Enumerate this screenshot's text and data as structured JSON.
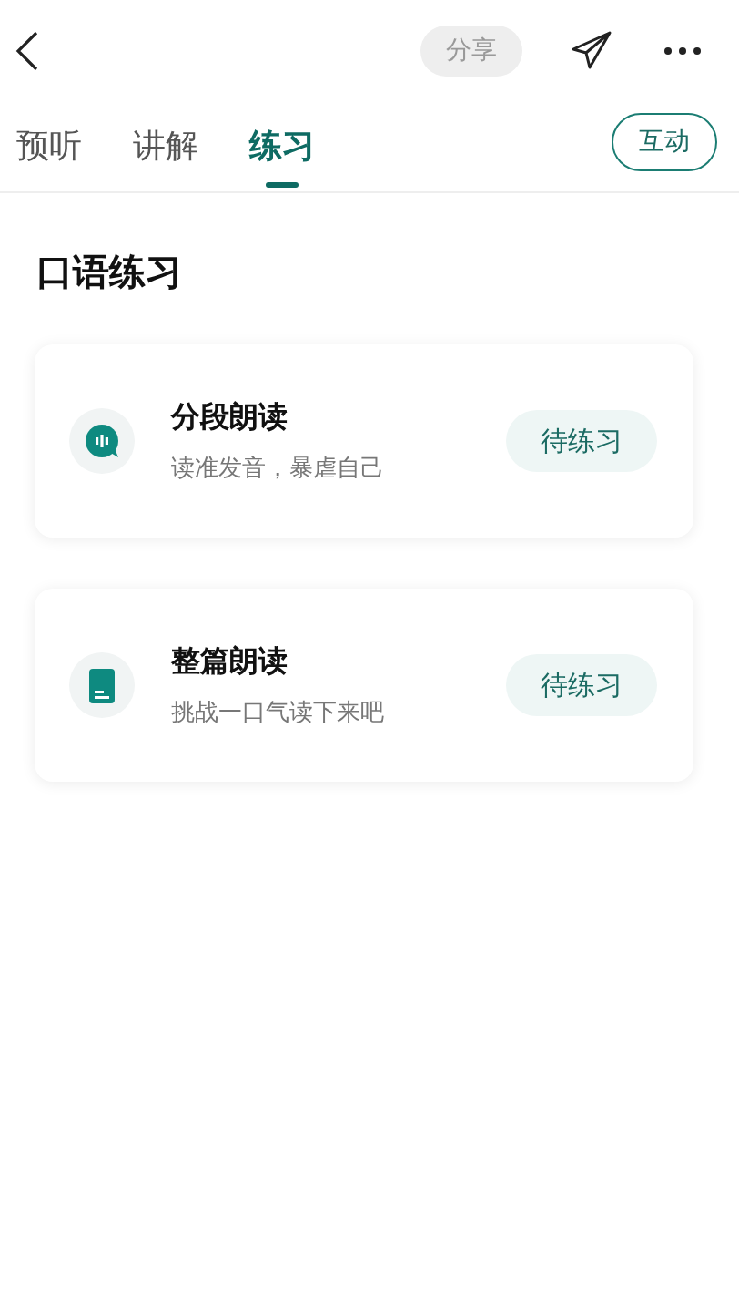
{
  "header": {
    "share_label": "分享"
  },
  "tabs": [
    {
      "label": "预听",
      "selected": false
    },
    {
      "label": "讲解",
      "selected": false
    },
    {
      "label": "练习",
      "selected": true
    }
  ],
  "interact_button": "互动",
  "section_title": "口语练习",
  "exercises": [
    {
      "title": "分段朗读",
      "subtitle": "读准发音，暴虐自己",
      "status": "待练习"
    },
    {
      "title": "整篇朗读",
      "subtitle": "挑战一口气读下来吧",
      "status": "待练习"
    }
  ]
}
